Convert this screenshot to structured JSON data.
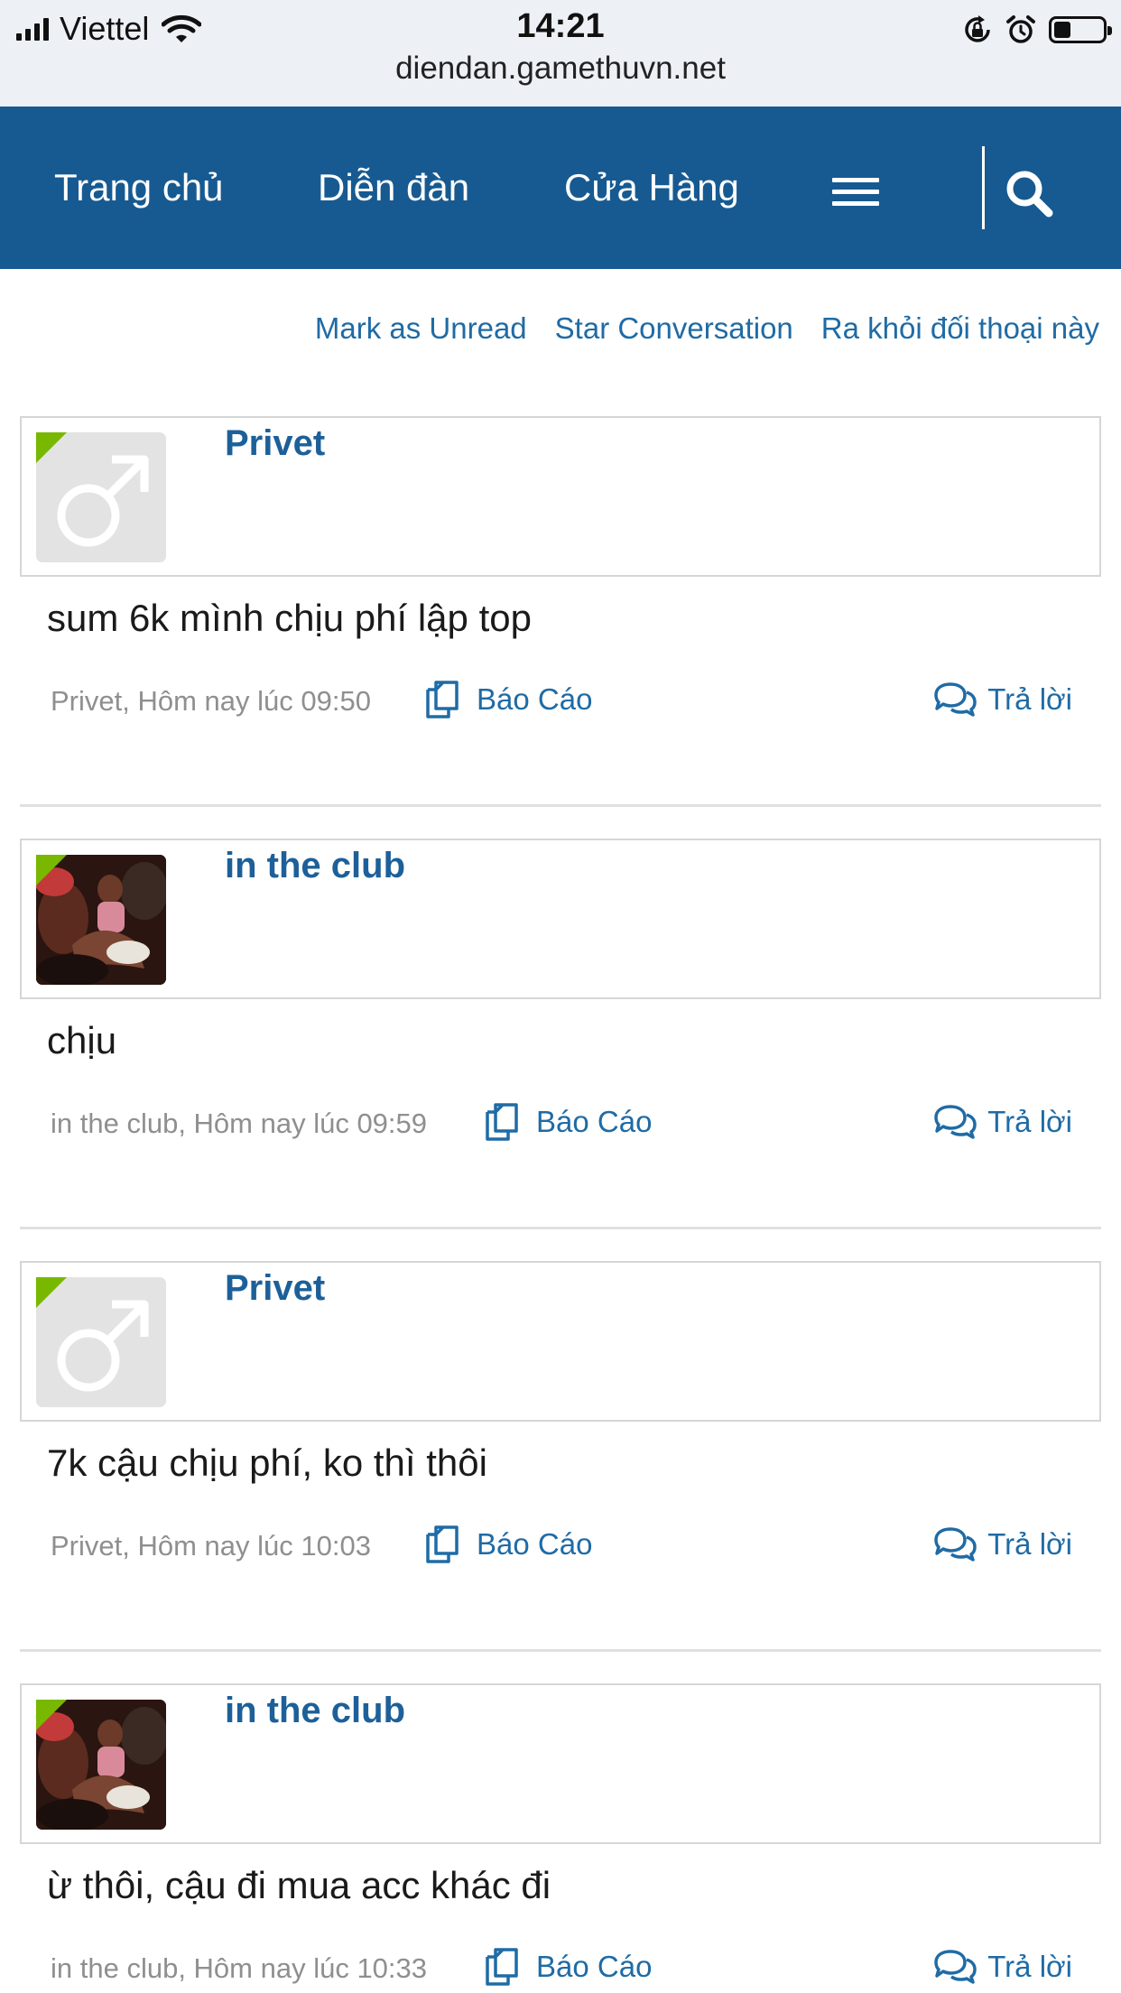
{
  "status_bar": {
    "carrier": "Viettel",
    "time": "14:21",
    "battery_level": 0.35
  },
  "browser": {
    "url": "diendan.gamethuvn.net"
  },
  "nav": {
    "home": "Trang chủ",
    "forums": "Diễn đàn",
    "store": "Cửa Hàng"
  },
  "actions": {
    "mark_unread": "Mark as Unread",
    "star": "Star Conversation",
    "leave": "Ra khỏi đối thoại này"
  },
  "messages": [
    {
      "user": "Privet",
      "avatar": "default-male-avatar",
      "text": "sum 6k mình chịu phí lập top",
      "meta": "Privet, Hôm nay lúc 09:50",
      "report": "Báo Cáo",
      "reply": "Trả lời"
    },
    {
      "user": "in the club",
      "avatar": "photo-avatar",
      "text": "chịu",
      "meta": "in the club, Hôm nay lúc 09:59",
      "report": "Báo Cáo",
      "reply": "Trả lời"
    },
    {
      "user": "Privet",
      "avatar": "default-male-avatar",
      "text": "7k cậu chịu phí, ko thì thôi",
      "meta": "Privet, Hôm nay lúc 10:03",
      "report": "Báo Cáo",
      "reply": "Trả lời"
    },
    {
      "user": "in the club",
      "avatar": "photo-avatar",
      "text": "ừ thôi, cậu đi mua acc khác đi",
      "meta": "in the club, Hôm nay lúc 10:33",
      "report": "Báo Cáo",
      "reply": "Trả lời"
    }
  ],
  "colors": {
    "navbar": "#175a92",
    "link": "#1f6ba5",
    "username": "#1d6099",
    "online_marker": "#78b800"
  }
}
